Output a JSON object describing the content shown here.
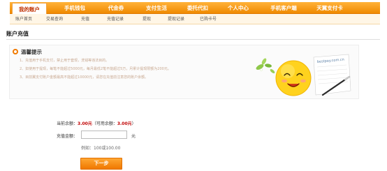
{
  "top_nav": {
    "tabs": [
      {
        "label": "我的账户",
        "active": true
      },
      {
        "label": "手机钱包",
        "active": false
      },
      {
        "label": "代金券",
        "active": false
      },
      {
        "label": "支付生活",
        "active": false
      },
      {
        "label": "委托代扣",
        "active": false
      },
      {
        "label": "个人中心",
        "active": false
      },
      {
        "label": "手机客户端",
        "active": false
      },
      {
        "label": "天翼支付卡",
        "active": false
      }
    ]
  },
  "sub_nav": {
    "items": [
      "账户首页",
      "交易查询",
      "充值",
      "充值记录",
      "提现",
      "提现记录",
      "已购卡号"
    ]
  },
  "page_title": "账户充值",
  "tips": {
    "title": "温馨提示",
    "lines": [
      "1、充值用于手机支付，禁止用于套现，洗钱等违法目的。",
      "2、如使用于提现，每笔不能超过5000元，每月最低2笔不能超过5万，月累计提现限额为200元。",
      "3、目前翼支付账户金额最高不能超过10000元，请您在充值前注意您的账户余额。"
    ],
    "illustration_text": "bestpay.com.cn"
  },
  "form": {
    "balance_label": "当前余额：",
    "balance_value": "3.00元",
    "available_label": "（可用余额：",
    "available_value": "3.00元",
    "available_close": "）",
    "amount_label": "充值金额：",
    "amount_value": "",
    "amount_unit": "元",
    "example": "例如：100或100.00",
    "next_button": "下一步"
  },
  "colors": {
    "nav_orange": "#f08a00",
    "balance_red": "#c00000"
  }
}
